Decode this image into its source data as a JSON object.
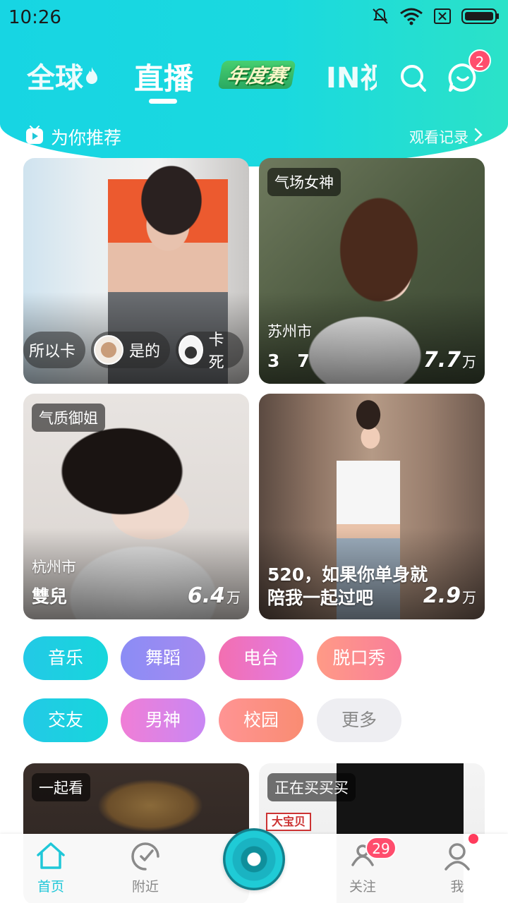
{
  "status_bar": {
    "time": "10:26"
  },
  "top_nav": {
    "tabs": [
      {
        "label": "全球",
        "icon": "flame-icon"
      },
      {
        "label": "直播",
        "selected": true
      },
      {
        "label": "年度赛"
      },
      {
        "label": "IN视"
      }
    ],
    "message_badge": "2"
  },
  "recommend": {
    "title": "为你推荐",
    "history_label": "观看记录"
  },
  "cards": [
    {
      "tag": "",
      "chips": [
        {
          "label": "所以卡",
          "avatar": false
        },
        {
          "label": "是的",
          "avatar": true
        },
        {
          "label": "卡死",
          "avatar": true
        }
      ]
    },
    {
      "tag": "气场女神",
      "city": "苏州市",
      "name": "3　7",
      "views_num": "7.7",
      "views_unit": "万"
    },
    {
      "tag": "气质御姐",
      "city": "杭州市",
      "name": "雙兒",
      "views_num": "6.4",
      "views_unit": "万"
    },
    {
      "caption": "520，如果你单身就陪我一起过吧",
      "views_num": "2.9",
      "views_unit": "万"
    },
    {
      "tag": "一起看"
    },
    {
      "tag": "正在买买买",
      "sign": "大宝贝"
    }
  ],
  "categories": [
    "音乐",
    "舞蹈",
    "电台",
    "脱口秀",
    "交友",
    "男神",
    "校园",
    "更多"
  ],
  "bottom_nav": {
    "items": [
      {
        "label": "首页",
        "icon": "home-icon",
        "active": true
      },
      {
        "label": "附近",
        "icon": "location-icon"
      },
      {
        "label": "",
        "icon": "live-camera-icon"
      },
      {
        "label": "关注",
        "icon": "follow-icon",
        "badge": "29"
      },
      {
        "label": "我",
        "icon": "profile-icon",
        "dot": true
      }
    ]
  },
  "colors": {
    "header_gradient_start": "#17d5e3",
    "header_gradient_end": "#2be2c8",
    "accent": "#1fc7d8",
    "badge": "#ff4d6d"
  }
}
